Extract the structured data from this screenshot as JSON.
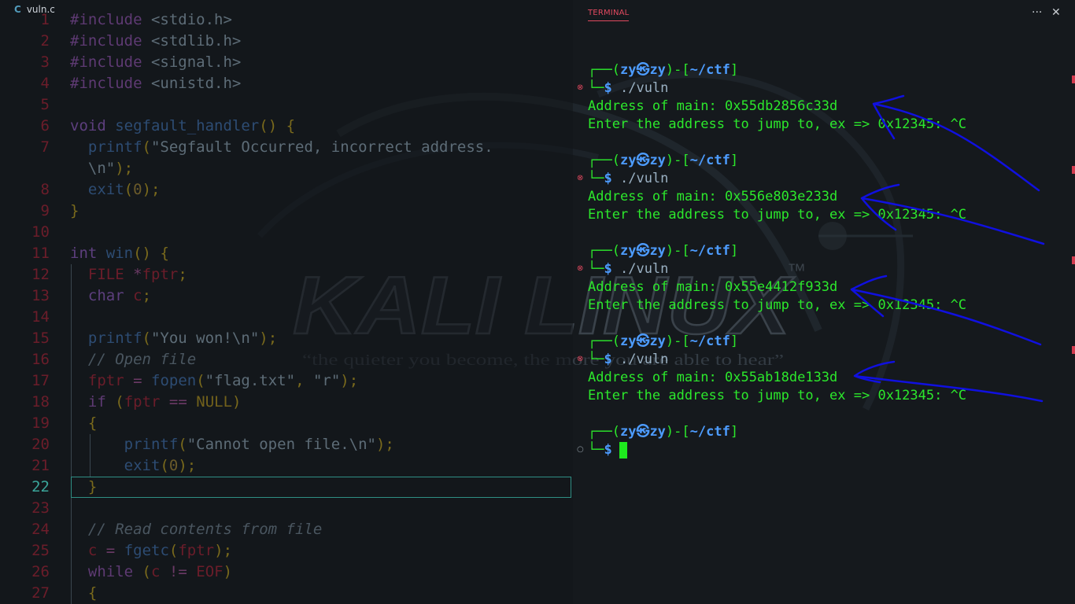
{
  "editor": {
    "tab": {
      "icon": "c-language-icon",
      "label": "vuln.c"
    },
    "active_line": "22",
    "lines": [
      {
        "n": "1",
        "t": "#include <stdio.h>"
      },
      {
        "n": "2",
        "t": "#include <stdlib.h>"
      },
      {
        "n": "3",
        "t": "#include <signal.h>"
      },
      {
        "n": "4",
        "t": "#include <unistd.h>"
      },
      {
        "n": "5",
        "t": ""
      },
      {
        "n": "6",
        "t": "void segfault_handler() {"
      },
      {
        "n": "7",
        "t": "  printf(\"Segfault Occurred, incorrect address."
      },
      {
        "n": "",
        "t": "  \\n\");"
      },
      {
        "n": "8",
        "t": "  exit(0);"
      },
      {
        "n": "9",
        "t": "}"
      },
      {
        "n": "10",
        "t": ""
      },
      {
        "n": "11",
        "t": "int win() {"
      },
      {
        "n": "12",
        "t": "  FILE *fptr;"
      },
      {
        "n": "13",
        "t": "  char c;"
      },
      {
        "n": "14",
        "t": ""
      },
      {
        "n": "15",
        "t": "  printf(\"You won!\\n\");"
      },
      {
        "n": "16",
        "t": "  // Open file"
      },
      {
        "n": "17",
        "t": "  fptr = fopen(\"flag.txt\", \"r\");"
      },
      {
        "n": "18",
        "t": "  if (fptr == NULL)"
      },
      {
        "n": "19",
        "t": "  {"
      },
      {
        "n": "20",
        "t": "      printf(\"Cannot open file.\\n\");"
      },
      {
        "n": "21",
        "t": "      exit(0);"
      },
      {
        "n": "22",
        "t": "  }"
      },
      {
        "n": "23",
        "t": ""
      },
      {
        "n": "24",
        "t": "  // Read contents from file"
      },
      {
        "n": "25",
        "t": "  c = fgetc(fptr);"
      },
      {
        "n": "26",
        "t": "  while (c != EOF)"
      },
      {
        "n": "27",
        "t": "  {"
      }
    ]
  },
  "watermark": {
    "brand": "KALI LINUX",
    "trademark": "™",
    "tagline": "“the quieter you become, the more you are able to hear”"
  },
  "terminal": {
    "tab_label": "TERMINAL",
    "icons": [
      "more-actions-icon",
      "close-icon"
    ],
    "more_glyph": "···",
    "close_glyph": "✕",
    "prompt": {
      "open": "┌──(",
      "user": "zy",
      "at": "㉿",
      "host": "zy",
      "mid": ")-[",
      "path": "~/ctf",
      "close": "]",
      "corner": "└─",
      "dollar": "$"
    },
    "runs": [
      {
        "cmd": "./vuln",
        "address_line": "Address of main: 0x55db2856c33d",
        "input_line": "Enter the address to jump to, ex => 0x12345: ^C",
        "status": "error"
      },
      {
        "cmd": "./vuln",
        "address_line": "Address of main: 0x556e803e233d",
        "input_line": "Enter the address to jump to, ex => 0x12345: ^C",
        "status": "error"
      },
      {
        "cmd": "./vuln",
        "address_line": "Address of main: 0x55e4412f933d",
        "input_line": "Enter the address to jump to, ex => 0x12345: ^C",
        "status": "error"
      },
      {
        "cmd": "./vuln",
        "address_line": "Address of main: 0x55ab18de133d",
        "input_line": "Enter the address to jump to, ex => 0x12345: ^C",
        "status": "error"
      }
    ],
    "status_glyph_error": "⊗",
    "status_glyph_idle": "○",
    "colors": {
      "output": "#2ce82c",
      "prompt": "#4d9cff",
      "error_mark": "#e0495f",
      "annotation": "#1010e0"
    }
  }
}
